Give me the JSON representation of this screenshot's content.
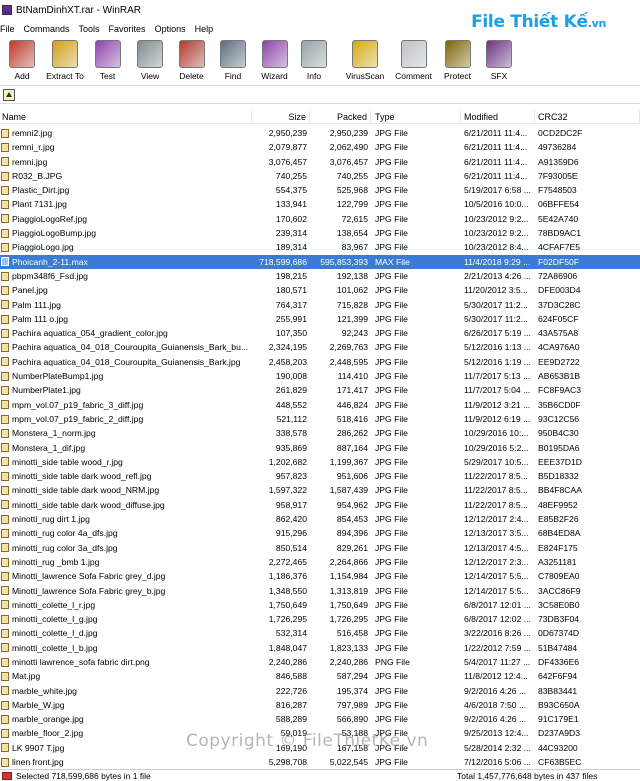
{
  "window": {
    "title": "BtNamDinhXT.rar - WinRAR"
  },
  "brand": {
    "text": "File Thiết Kế",
    "suffix": ".vn"
  },
  "menu": [
    "File",
    "Commands",
    "Tools",
    "Favorites",
    "Options",
    "Help"
  ],
  "toolbar": [
    {
      "label": "Add",
      "icon": "add-books-icon",
      "color": "#c0392b"
    },
    {
      "label": "Extract To",
      "icon": "extract-folder-icon",
      "color": "#d4a017"
    },
    {
      "label": "Test",
      "icon": "test-check-icon",
      "color": "#8e44ad"
    },
    {
      "label": "View",
      "icon": "view-glasses-icon",
      "color": "#7f8c8d"
    },
    {
      "label": "Delete",
      "icon": "delete-books-icon",
      "color": "#b03a2e"
    },
    {
      "label": "Find",
      "icon": "find-binoculars-icon",
      "color": "#5d6d7e"
    },
    {
      "label": "Wizard",
      "icon": "wizard-wand-icon",
      "color": "#8e44ad"
    },
    {
      "label": "Info",
      "icon": "info-icon",
      "color": "#95a5a6"
    },
    {
      "label": "VirusScan",
      "icon": "virus-scan-icon",
      "color": "#d4ac0d"
    },
    {
      "label": "Comment",
      "icon": "comment-note-icon",
      "color": "#bdc3c7"
    },
    {
      "label": "Protect",
      "icon": "protect-shield-icon",
      "color": "#7d6608"
    },
    {
      "label": "SFX",
      "icon": "sfx-archive-icon",
      "color": "#6c3483"
    }
  ],
  "columns": [
    "Name",
    "Size",
    "Packed",
    "Type",
    "Modified",
    "CRC32"
  ],
  "files": [
    [
      "remni2.jpg",
      "2,950,239",
      "2,950,239",
      "JPG File",
      "6/21/2011 11:4...",
      "0CD2DC2F"
    ],
    [
      "remni_r.jpg",
      "2,079,877",
      "2,062,490",
      "JPG File",
      "6/21/2011 11:4...",
      "49736284"
    ],
    [
      "remni.jpg",
      "3,076,457",
      "3,076,457",
      "JPG File",
      "6/21/2011 11:4...",
      "A91359D6"
    ],
    [
      "R032_B.JPG",
      "740,255",
      "740,255",
      "JPG File",
      "6/21/2011 11:4...",
      "7F93005E"
    ],
    [
      "Plastic_Dirt.jpg",
      "554,375",
      "525,968",
      "JPG File",
      "5/19/2017 6:58 ...",
      "F7548503"
    ],
    [
      "Plant 7131.jpg",
      "133,941",
      "122,799",
      "JPG File",
      "10/5/2016 10:0...",
      "06BFFE54"
    ],
    [
      "PiaggioLogoRef.jpg",
      "170,602",
      "72,615",
      "JPG File",
      "10/23/2012 9:2...",
      "5E42A740"
    ],
    [
      "PiaggioLogoBump.jpg",
      "239,314",
      "138,654",
      "JPG File",
      "10/23/2012 9:2...",
      "78BD9AC1"
    ],
    [
      "PiaggioLogo.jpg",
      "189,314",
      "83,967",
      "JPG File",
      "10/23/2012 8:4...",
      "4CFAF7E5"
    ],
    [
      "Phoicanh_2-11.max",
      "718,599,686",
      "595,853,393",
      "MAX File",
      "11/4/2018 9:29 ...",
      "F02DF50F"
    ],
    [
      "pbpm348f6_Fsd.jpg",
      "198,215",
      "192,138",
      "JPG File",
      "2/21/2013 4:26 ...",
      "72A86906"
    ],
    [
      "Panel.jpg",
      "180,571",
      "101,062",
      "JPG File",
      "11/20/2012 3:5...",
      "DFE003D4"
    ],
    [
      "Palm 111.jpg",
      "764,317",
      "715,828",
      "JPG File",
      "5/30/2017 11:2...",
      "37D3C28C"
    ],
    [
      "Palm 111 o.jpg",
      "255,991",
      "121,399",
      "JPG File",
      "5/30/2017 11:2...",
      "624F05CF"
    ],
    [
      "Pachira aquatica_054_gradient_color.jpg",
      "107,350",
      "92,243",
      "JPG File",
      "6/26/2017 5:19 ...",
      "43A575A8"
    ],
    [
      "Pachira aquatica_04_018_Couroupita_Guianensis_Bark_bu...",
      "2,324,195",
      "2,269,763",
      "JPG File",
      "5/12/2016 1:13 ...",
      "4CA976A0"
    ],
    [
      "Pachira aquatica_04_018_Couroupita_Guianensis_Bark.jpg",
      "2,458,203",
      "2,448,595",
      "JPG File",
      "5/12/2016 1:19 ...",
      "EE9D2722"
    ],
    [
      "NumberPlateBump1.jpg",
      "190,008",
      "114,410",
      "JPG File",
      "11/7/2017 5:13 ...",
      "AB653B1B"
    ],
    [
      "NumberPlate1.jpg",
      "261,829",
      "171,417",
      "JPG File",
      "11/7/2017 5:04 ...",
      "FC8F9AC3"
    ],
    [
      "mpm_vol.07_p19_fabric_3_diff.jpg",
      "448,552",
      "446,824",
      "JPG File",
      "11/9/2012 3:21 ...",
      "35B6CD0F"
    ],
    [
      "mpm_vol.07_p19_fabric_2_diff.jpg",
      "521,112",
      "518,416",
      "JPG File",
      "11/9/2012 6:19 ...",
      "93C12C56"
    ],
    [
      "Monstera_1_norm.jpg",
      "338,578",
      "286,262",
      "JPG File",
      "10/29/2016 10:...",
      "950B4C30"
    ],
    [
      "Monstera_1_dif.jpg",
      "935,869",
      "887,164",
      "JPG File",
      "10/29/2016 5:2...",
      "B0195DA6"
    ],
    [
      "minotti_side table wood_r.jpg",
      "1,202,682",
      "1,199,367",
      "JPG File",
      "5/29/2017 10:5...",
      "EEE37D1D"
    ],
    [
      "minotti_side table dark wood_refl.jpg",
      "957,823",
      "951,606",
      "JPG File",
      "11/22/2017 8:5...",
      "B5D18332"
    ],
    [
      "minotti_side table dark wood_NRM.jpg",
      "1,597,322",
      "1,587,439",
      "JPG File",
      "11/22/2017 8:5...",
      "BB4F8CAA"
    ],
    [
      "minotti_side table dark wood_diffuse.jpg",
      "958,917",
      "954,962",
      "JPG File",
      "11/22/2017 8:5...",
      "48EF9952"
    ],
    [
      "minotti_rug dirt 1.jpg",
      "862,420",
      "854,453",
      "JPG File",
      "12/12/2017 2:4...",
      "E85B2F26"
    ],
    [
      "minotti_rug color 4a_dfs.jpg",
      "915,296",
      "894,396",
      "JPG File",
      "12/13/2017 3:5...",
      "68B4ED8A"
    ],
    [
      "minotti_rug color 3a_dfs.jpg",
      "850,514",
      "829,261",
      "JPG File",
      "12/13/2017 4:5...",
      "E824F175"
    ],
    [
      "minotti_rug _bmb 1.jpg",
      "2,272,465",
      "2,264,866",
      "JPG File",
      "12/12/2017 2:3...",
      "A3251181"
    ],
    [
      "Minotti_lawrence Sofa Fabric grey_d.jpg",
      "1,186,376",
      "1,154,984",
      "JPG File",
      "12/14/2017 5:5...",
      "C7809EA0"
    ],
    [
      "Minotti_lawrence Sofa Fabric grey_b.jpg",
      "1,348,550",
      "1,313,819",
      "JPG File",
      "12/14/2017 5:5...",
      "3ACC86F9"
    ],
    [
      "minotti_colette_l_r.jpg",
      "1,750,649",
      "1,750,649",
      "JPG File",
      "6/8/2017 12:01 ...",
      "3C58E0B0"
    ],
    [
      "minotti_colette_l_g.jpg",
      "1,726,295",
      "1,726,295",
      "JPG File",
      "6/8/2017 12:02 ...",
      "73DB3F04"
    ],
    [
      "minotti_colette_l_d.jpg",
      "532,314",
      "516,458",
      "JPG File",
      "3/22/2016 8:26 ...",
      "0D67374D"
    ],
    [
      "minotti_colette_l_b.jpg",
      "1,848,047",
      "1,823,133",
      "JPG File",
      "1/22/2012 7:59 ...",
      "51B47484"
    ],
    [
      "minotti lawrence_sofa fabric dirt.png",
      "2,240,286",
      "2,240,286",
      "PNG File",
      "5/4/2017 11:27 ...",
      "DF4336E6"
    ],
    [
      "Mat.jpg",
      "846,588",
      "587,294",
      "JPG File",
      "11/8/2012 12:4...",
      "642F6F94"
    ],
    [
      "marble_white.jpg",
      "222,726",
      "195,374",
      "JPG File",
      "9/2/2016 4:26 ...",
      "83B83441"
    ],
    [
      "Marble_W.jpg",
      "816,287",
      "797,989",
      "JPG File",
      "4/6/2018 7:50 ...",
      "B93C650A"
    ],
    [
      "marble_orange.jpg",
      "588,289",
      "566,890",
      "JPG File",
      "9/2/2016 4:26 ...",
      "91C179E1"
    ],
    [
      "marble_floor_2.jpg",
      "59,019",
      "53,188",
      "JPG File",
      "9/25/2013 12:4...",
      "D237A9D3"
    ],
    [
      "LK 9907 T.jpg",
      "169,190",
      "167,158",
      "JPG File",
      "5/28/2014 2:32 ...",
      "44C93200"
    ],
    [
      "linen front.jpg",
      "5,298,708",
      "5,022,545",
      "JPG File",
      "7/12/2016 5:06 ...",
      "CF63B5EC"
    ]
  ],
  "selected_index": 9,
  "status": {
    "left": "Selected 718,599,686 bytes in 1 file",
    "right": "Total 1,457,776,648 bytes in 437 files"
  },
  "watermark": "Copyright © FileThietKe.vn"
}
